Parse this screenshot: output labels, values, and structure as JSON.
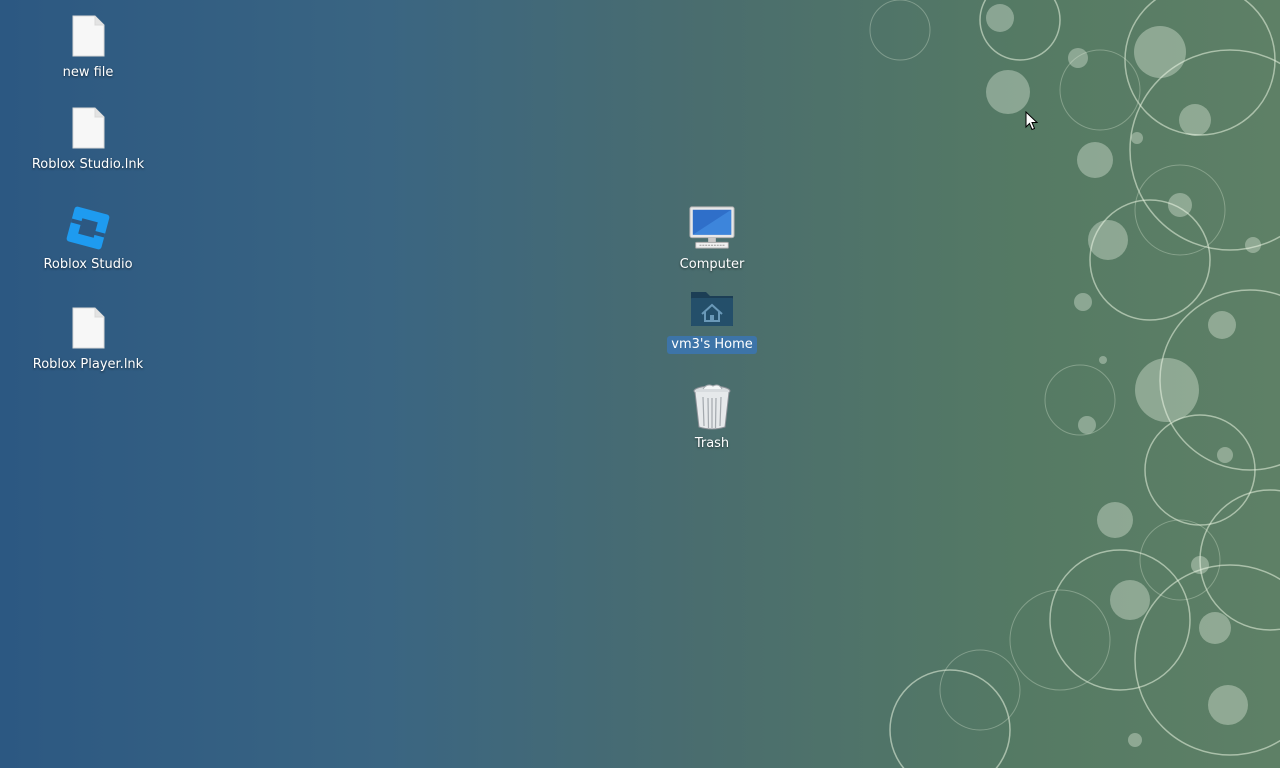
{
  "desktop": {
    "icons": [
      {
        "label": "new file",
        "icon": "blank-file-icon"
      },
      {
        "label": "Roblox Studio.lnk",
        "icon": "blank-file-icon"
      },
      {
        "label": "Roblox Studio",
        "icon": "roblox-studio-icon"
      },
      {
        "label": "Roblox Player.lnk",
        "icon": "blank-file-icon"
      },
      {
        "label": "Computer",
        "icon": "computer-monitor-icon"
      },
      {
        "label": "vm3's Home",
        "icon": "home-folder-icon",
        "selected": true
      },
      {
        "label": "Trash",
        "icon": "trash-bin-icon"
      }
    ]
  },
  "colors": {
    "selection_highlight": "#3d74a8",
    "roblox_blue": "#1e9bf0",
    "wallpaper_left": "#2c5882",
    "wallpaper_right": "#5e8066"
  }
}
